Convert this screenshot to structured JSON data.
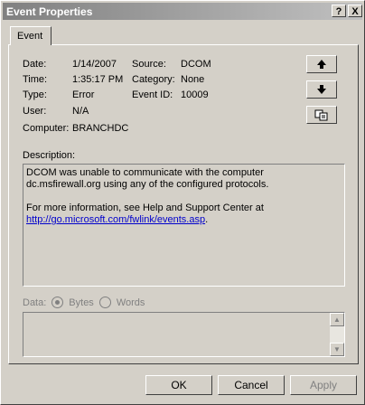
{
  "window": {
    "title": "Event Properties",
    "help_glyph": "?",
    "close_glyph": "X"
  },
  "tab": {
    "label": "Event"
  },
  "fields": {
    "date_label": "Date:",
    "date_value": "1/14/2007",
    "time_label": "Time:",
    "time_value": "1:35:17 PM",
    "type_label": "Type:",
    "type_value": "Error",
    "user_label": "User:",
    "user_value": "N/A",
    "computer_label": "Computer:",
    "computer_value": "BRANCHDC",
    "source_label": "Source:",
    "source_value": "DCOM",
    "category_label": "Category:",
    "category_value": "None",
    "eventid_label": "Event ID:",
    "eventid_value": "10009"
  },
  "description": {
    "label": "Description:",
    "line1": "DCOM was unable to communicate with the computer dc.msfirewall.org using any of the configured protocols.",
    "line2": "For more information, see Help and Support Center at",
    "link": "http://go.microsoft.com/fwlink/events.asp",
    "link_suffix": "."
  },
  "data": {
    "label": "Data:",
    "bytes_label": "Bytes",
    "words_label": "Words",
    "selected": "Bytes"
  },
  "buttons": {
    "ok": "OK",
    "cancel": "Cancel",
    "apply": "Apply"
  }
}
